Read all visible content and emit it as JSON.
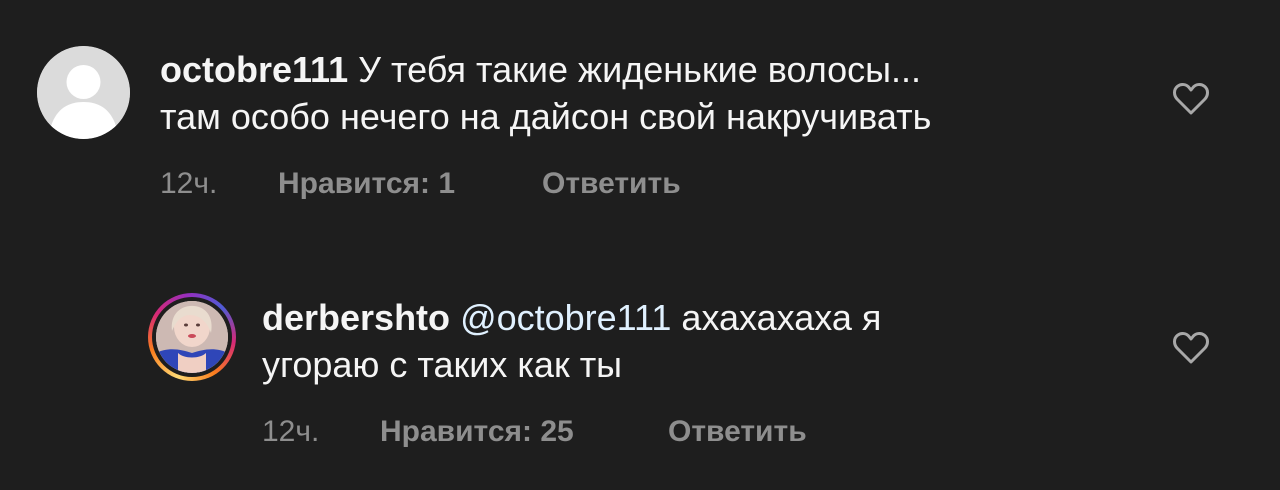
{
  "comments": [
    {
      "username": "octobre111",
      "text_line1": "У тебя такие жиденькие волосы...",
      "text_line2": "там особо нечего на дайсон свой накручивать",
      "time": "12ч.",
      "likes": "Нравится: 1",
      "reply": "Ответить",
      "avatar": "default-avatar-icon"
    },
    {
      "username": "derbershto",
      "mention": "@octobre111",
      "text_line1": "ахахахаха я",
      "text_line2": "угораю с таких как ты",
      "time": "12ч.",
      "likes": "Нравится: 25",
      "reply": "Ответить",
      "avatar": "profile-photo"
    }
  ],
  "colors": {
    "background": "#1e1e1e",
    "text": "#f5f5f5",
    "meta": "#8e8e8e",
    "mention": "#e0f1ff",
    "heart": "#a8a8a8"
  },
  "icons": {
    "like": "heart-outline-icon"
  }
}
